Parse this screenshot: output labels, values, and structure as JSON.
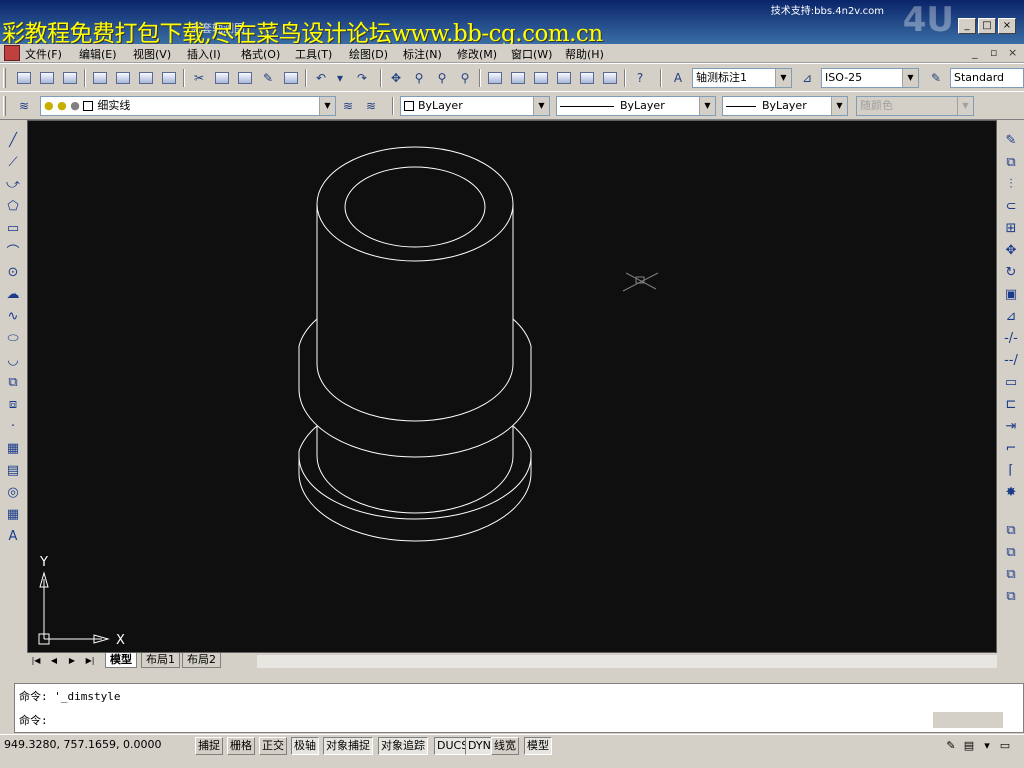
{
  "window": {
    "support_text": "技术支持:bbs.4n2v.com",
    "watermark": "彩教程免费打包下载,尽在菜鸟设计论坛www.bb-cg.com.cn",
    "title_partial": "盘套轴测图",
    "logo_text": "4U"
  },
  "menu": {
    "items": [
      "文件(F)",
      "编辑(E)",
      "视图(V)",
      "插入(I)",
      "格式(O)",
      "工具(T)",
      "绘图(D)",
      "标注(N)",
      "修改(M)",
      "窗口(W)",
      "帮助(H)"
    ]
  },
  "standard_toolbar": {
    "dimstyle_value": "轴测标注1",
    "textstyle_value": "ISO-25",
    "tablestyle_value": "Standard"
  },
  "layers_toolbar": {
    "layer_value": "细实线",
    "color_value": "ByLayer",
    "linetype_value": "ByLayer",
    "lineweight_value": "ByLayer",
    "plotstyle_value": "随颜色"
  },
  "ucs": {
    "x_label": "X",
    "y_label": "Y"
  },
  "tabs": {
    "model": "模型",
    "layout1": "布局1",
    "layout2": "布局2"
  },
  "command": {
    "history_prefix": "命令:",
    "history_value": "'_dimstyle",
    "prompt": "命令:"
  },
  "status": {
    "coordinates": "949.3280,  757.1659, 0.0000",
    "buttons": [
      "捕捉",
      "栅格",
      "正交",
      "极轴",
      "对象捕捉",
      "对象追踪",
      "DUCS",
      "DYN",
      "线宽",
      "模型"
    ],
    "active": [
      "极轴",
      "对象捕捉",
      "对象追踪",
      "DUCS",
      "DYN",
      "模型"
    ]
  }
}
